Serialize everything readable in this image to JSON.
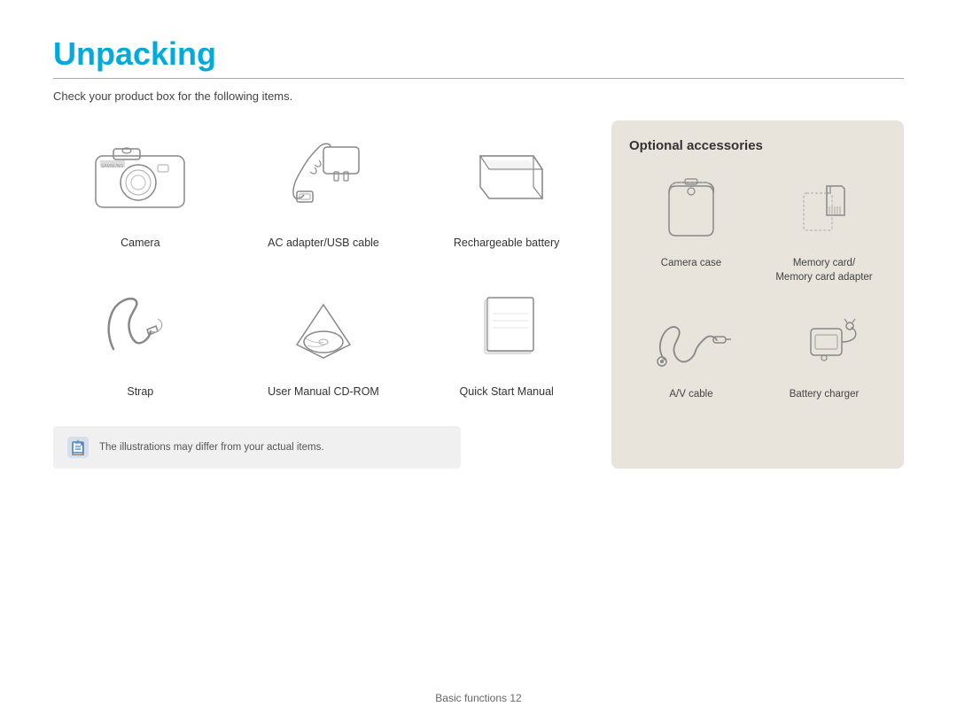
{
  "page": {
    "title": "Unpacking",
    "subtitle": "Check your product box for the following items.",
    "footer": "Basic functions  12"
  },
  "items": [
    {
      "id": "camera",
      "label": "Camera"
    },
    {
      "id": "ac-adapter",
      "label": "AC adapter/USB cable"
    },
    {
      "id": "battery",
      "label": "Rechargeable battery"
    },
    {
      "id": "strap",
      "label": "Strap"
    },
    {
      "id": "cd-rom",
      "label": "User Manual CD-ROM"
    },
    {
      "id": "quick-start",
      "label": "Quick Start Manual"
    }
  ],
  "note": {
    "text": "The illustrations may differ from your actual items."
  },
  "optional": {
    "title": "Optional accessories",
    "items": [
      {
        "id": "camera-case",
        "label": "Camera case"
      },
      {
        "id": "memory-card",
        "label": "Memory card/\nMemory card adapter"
      },
      {
        "id": "av-cable",
        "label": "A/V cable"
      },
      {
        "id": "battery-charger",
        "label": "Battery charger"
      }
    ]
  }
}
